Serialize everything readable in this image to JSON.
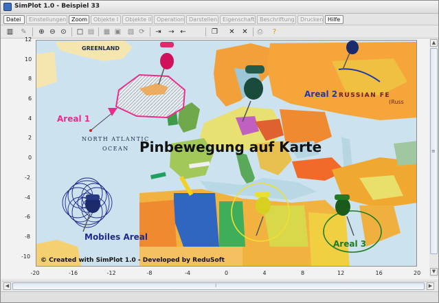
{
  "window": {
    "title": "SimPlot 1.0 - Beispiel 33"
  },
  "menu": [
    {
      "label": "Datei",
      "active": true
    },
    {
      "label": "Einstellungen",
      "active": false
    },
    {
      "label": "Zoom",
      "active": true
    },
    {
      "label": "Objekte I",
      "active": false
    },
    {
      "label": "Objekte II",
      "active": false
    },
    {
      "label": "Operation",
      "active": false
    },
    {
      "label": "Darstellen",
      "active": false
    },
    {
      "label": "Eigenschaft",
      "active": false
    },
    {
      "label": "Beschriftung",
      "active": false
    },
    {
      "label": "Drucken",
      "active": false
    },
    {
      "label": "Hilfe",
      "active": true
    }
  ],
  "axes": {
    "x_ticks": [
      "-20",
      "-16",
      "-12",
      "-8",
      "-4",
      "0",
      "4",
      "8",
      "12",
      "16",
      "20"
    ],
    "y_ticks": [
      "12",
      "10",
      "8",
      "6",
      "4",
      "2",
      "0",
      "-2",
      "-4",
      "-6",
      "-8",
      "-10"
    ],
    "x_range": [
      -20,
      20
    ],
    "y_range": [
      -11,
      12
    ]
  },
  "map": {
    "title": "Pinbewegung auf Karte",
    "credit": "© Created with SimPlot 1.0 - Developed by ReduSoft",
    "region_labels": [
      "GREENLAND",
      "RUSSIAN FE",
      "(Russ",
      "NORTH ATLANTIC",
      "OCEAN"
    ],
    "areas": [
      {
        "label": "Areal 1",
        "color": "#ee2a8a"
      },
      {
        "label": "Areal 2",
        "color": "#1f3aa8"
      },
      {
        "label": "Mobiles Areal",
        "color": "#1f2a8f"
      },
      {
        "label": "Areal 3",
        "color": "#1e7a1e"
      }
    ]
  },
  "toolbar_icons": [
    "calculator-icon",
    "pen-icon",
    "zoom-in-icon",
    "zoom-out-icon",
    "zoom-fit-icon",
    "rectangle-icon",
    "table-icon",
    "grid-icon",
    "grid2-icon",
    "export-icon",
    "refresh-icon",
    "import-icon",
    "arrow-right-icon",
    "arrow-left-icon",
    "copy-icon",
    "delete-icon",
    "delete-all-icon",
    "print-icon",
    "help-icon"
  ]
}
